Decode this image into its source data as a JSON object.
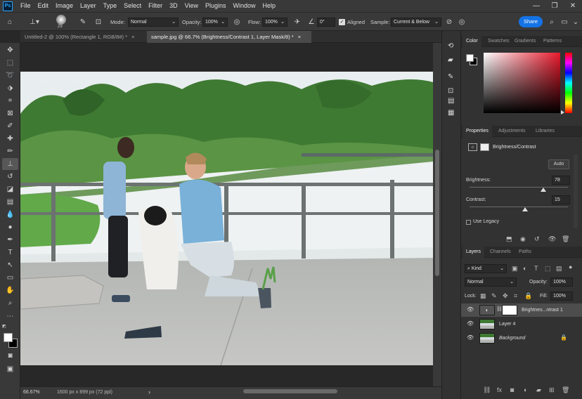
{
  "app": {
    "logo": "Ps"
  },
  "menu": [
    "File",
    "Edit",
    "Image",
    "Layer",
    "Type",
    "Select",
    "Filter",
    "3D",
    "View",
    "Plugins",
    "Window",
    "Help"
  ],
  "window_controls": {
    "minimize": "—",
    "restore": "❐",
    "close": "✕"
  },
  "options": {
    "brush_size": "29",
    "mode_label": "Mode:",
    "mode_value": "Normal",
    "opacity_label": "Opacity:",
    "opacity_value": "100%",
    "flow_label": "Flow:",
    "flow_value": "100%",
    "angle_value": "0°",
    "aligned_label": "Aligned",
    "sample_label": "Sample:",
    "sample_value": "Current & Below",
    "share_label": "Share"
  },
  "doc_tabs": [
    {
      "label": "Untitled-2 @ 100% (Rectangle 1, RGB/8#) *",
      "close": "×"
    },
    {
      "label": "sample.jpg @ 66.7% (Brightness/Contrast 1, Layer Mask/8) *",
      "close": "×"
    }
  ],
  "status": {
    "zoom": "66.67%",
    "doc_info": "1600 px x 899 px (72 ppi)",
    "arrow": "›"
  },
  "color_panel": {
    "tabs": [
      "Color",
      "Swatches",
      "Gradients",
      "Patterns"
    ],
    "hue_color": "#e8192c"
  },
  "properties": {
    "tabs": [
      "Properties",
      "Adjustments",
      "Libraries"
    ],
    "type_label": "Brightness/Contrast",
    "auto_label": "Auto",
    "brightness_label": "Brightness:",
    "brightness_value": "78",
    "contrast_label": "Contrast:",
    "contrast_value": "15",
    "legacy_label": "Use Legacy"
  },
  "layers_panel": {
    "tabs": [
      "Layers",
      "Channels",
      "Paths"
    ],
    "kind_label": "Kind",
    "blend_value": "Normal",
    "opacity_label": "Opacity:",
    "opacity_value": "100%",
    "lock_label": "Lock:",
    "fill_label": "Fill:",
    "fill_value": "100%",
    "layers": [
      {
        "name": "Brightnes...ntrast 1"
      },
      {
        "name": "Layer 4"
      },
      {
        "name": "Background"
      }
    ]
  }
}
